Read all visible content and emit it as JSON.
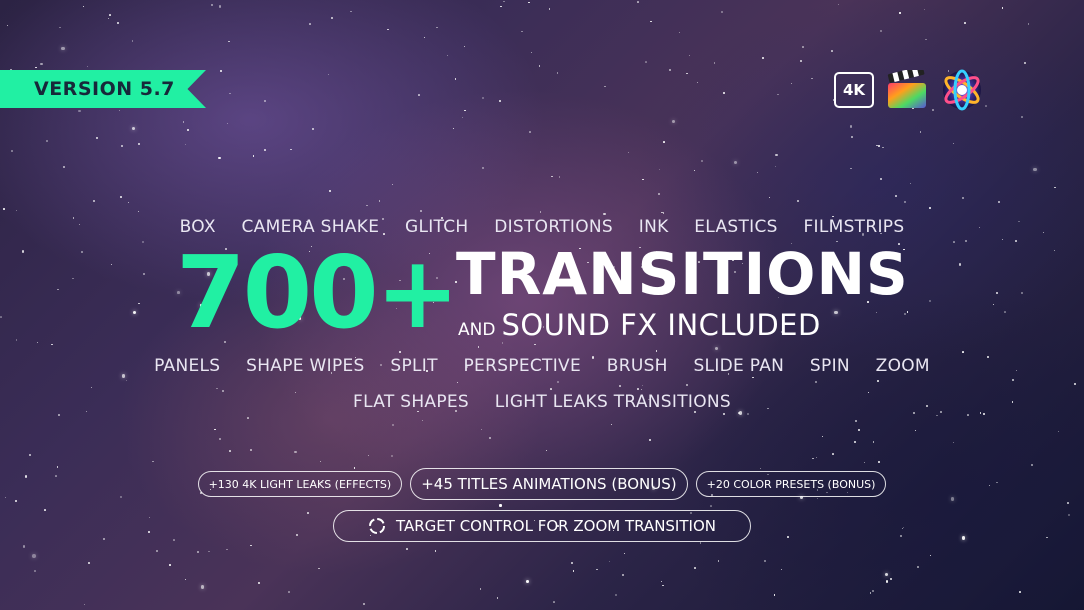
{
  "version_ribbon": {
    "label": "VERSION 5.7",
    "color": "#21f0a3"
  },
  "badges": {
    "resolution": "4K",
    "icons": [
      "final-cut-pro-icon",
      "motion-icon"
    ]
  },
  "tags_top": [
    "BOX",
    "CAMERA SHAKE",
    "GLITCH",
    "DISTORTIONS",
    "INK",
    "ELASTICS",
    "FILMSTRIPS"
  ],
  "headline": {
    "count": "700+",
    "title": "TRANSITIONS",
    "subtitle_and": "AND",
    "subtitle_rest": "SOUND FX INCLUDED",
    "accent_color": "#21f0a3"
  },
  "tags_middle": [
    "PANELS",
    "SHAPE WIPES",
    "SPLIT",
    "PERSPECTIVE",
    "BRUSH",
    "SLIDE PAN",
    "SPIN",
    "ZOOM"
  ],
  "tags_bottom": [
    "FLAT SHAPES",
    "LIGHT LEAKS TRANSITIONS"
  ],
  "bonus_pills": [
    {
      "label": "+130 4K LIGHT LEAKS (EFFECTS)"
    },
    {
      "label": "+45 TITLES ANIMATIONS (BONUS)"
    },
    {
      "label": "+20 COLOR PRESETS (BONUS)"
    }
  ],
  "target_control": {
    "label": "TARGET CONTROL FOR ZOOM TRANSITION",
    "icon": "target-icon"
  }
}
